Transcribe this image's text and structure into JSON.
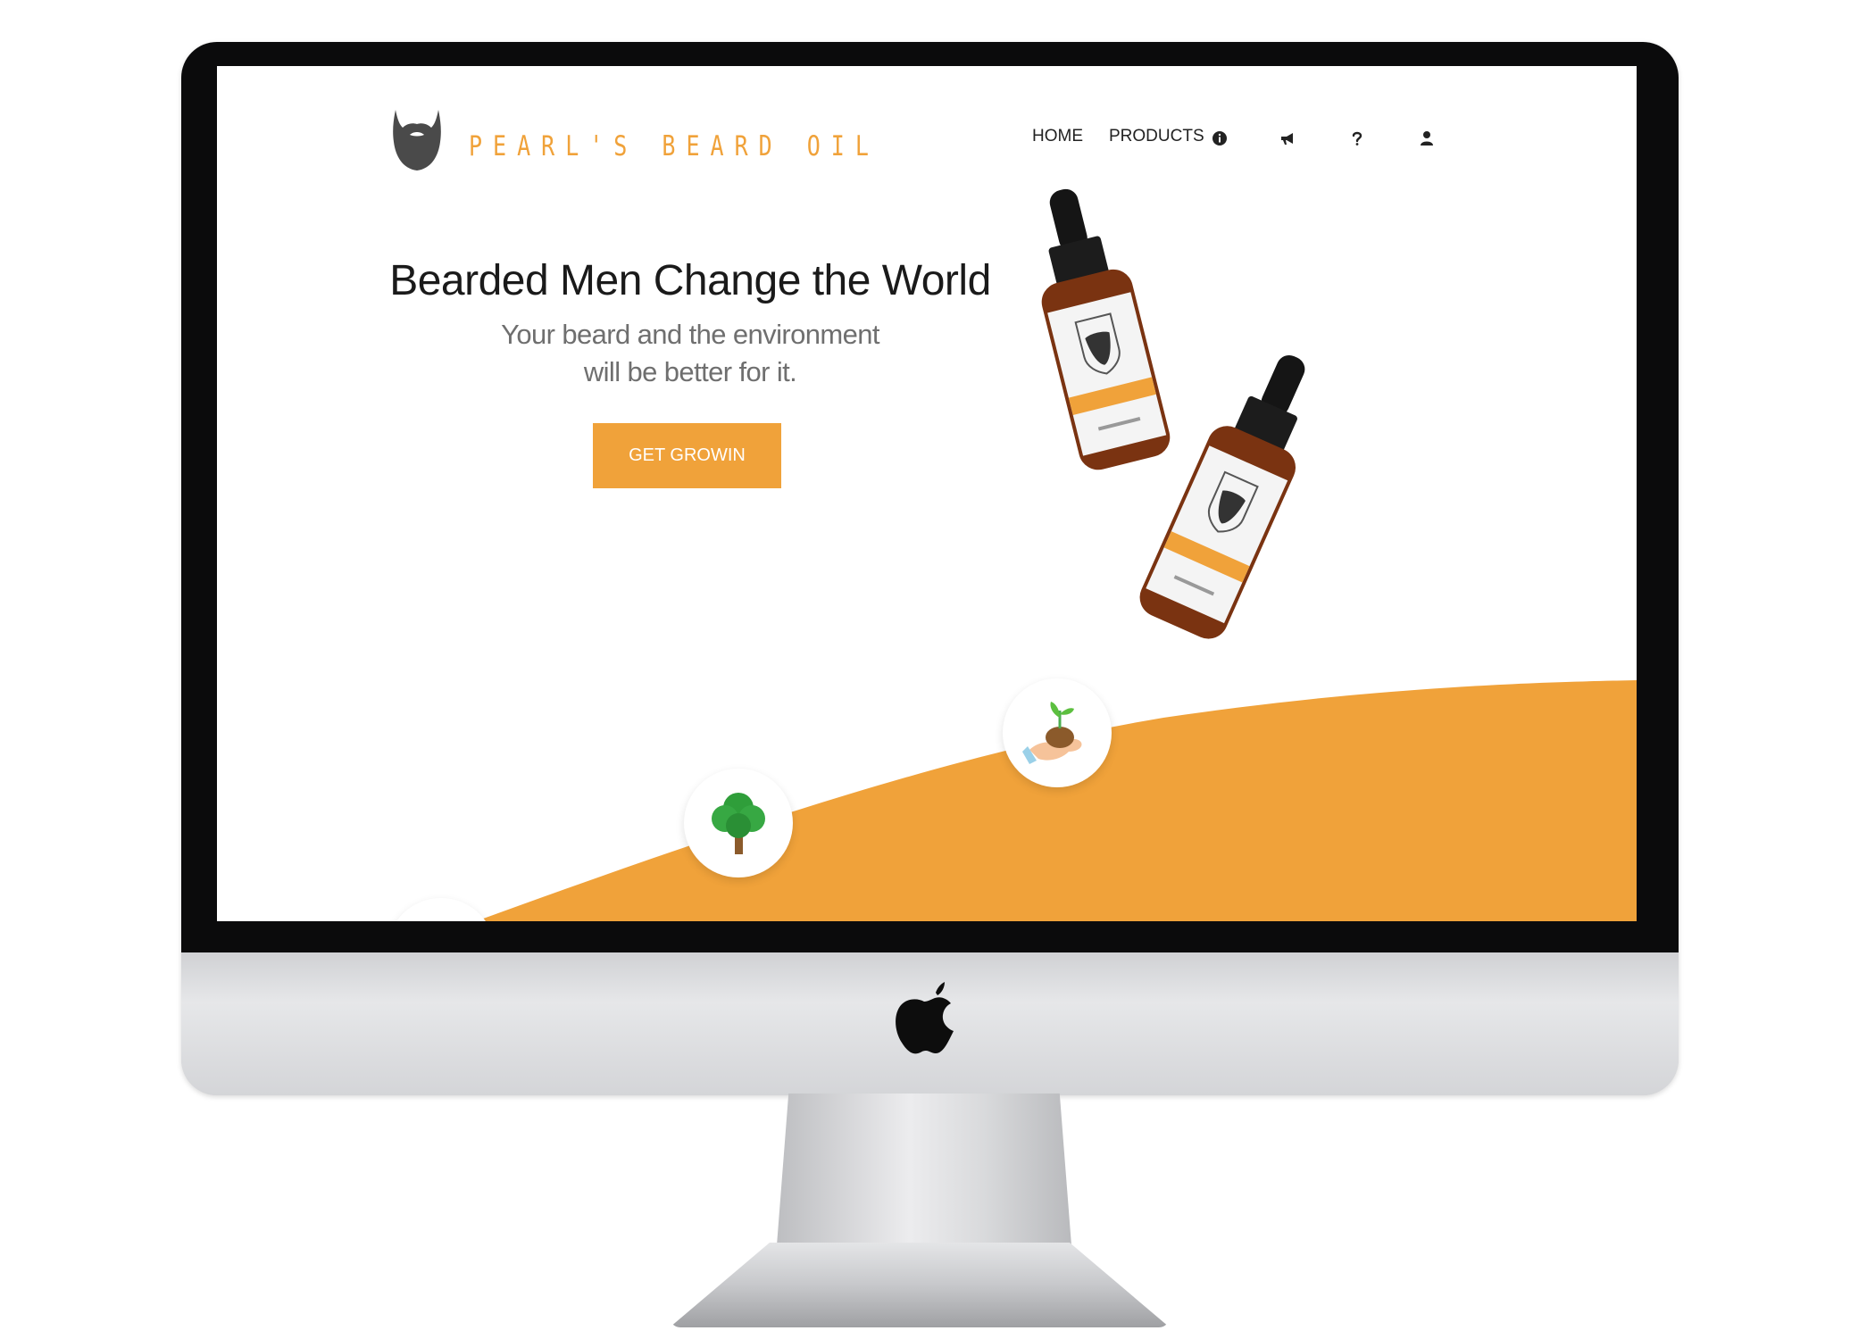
{
  "site": {
    "brand_name": "PEARL'S BEARD OIL",
    "accent_color": "#f0a23a",
    "nav": {
      "home_label": "HOME",
      "products_label": "PRODUCTS",
      "icons": [
        "info-icon",
        "megaphone-icon",
        "question-icon",
        "user-icon"
      ]
    },
    "hero": {
      "title": "Bearded Men Change the World",
      "subtitle_line1": "Your beard and the environment",
      "subtitle_line2": "will be better for it.",
      "cta_label": "GET GROWIN"
    },
    "features": [
      "tree-icon",
      "seedling-hand-icon"
    ]
  },
  "device": {
    "type": "imac",
    "logo": "apple-icon"
  }
}
